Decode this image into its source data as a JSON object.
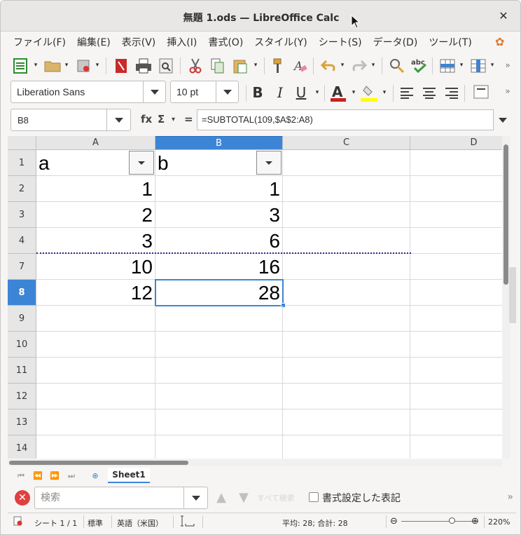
{
  "window": {
    "title": "無題 1.ods — LibreOffice Calc",
    "close": "✕"
  },
  "menubar": [
    "ファイル(F)",
    "編集(E)",
    "表示(V)",
    "挿入(I)",
    "書式(O)",
    "スタイル(Y)",
    "シート(S)",
    "データ(D)",
    "ツール(T)"
  ],
  "toolbar2": {
    "font_name": "Liberation Sans",
    "font_size": "10 pt",
    "bold": "B",
    "italic": "I",
    "underline": "U"
  },
  "formula_bar": {
    "name_box": "B8",
    "fx": "fx",
    "sigma": "Σ",
    "equals": "=",
    "formula": "=SUBTOTAL(109,$A$2:A8)"
  },
  "grid": {
    "columns": [
      "A",
      "B",
      "C",
      "D"
    ],
    "selected_column": "B",
    "rows": [
      {
        "num": "1",
        "a": "a",
        "b": "b"
      },
      {
        "num": "2",
        "a": "1",
        "b": "1"
      },
      {
        "num": "3",
        "a": "2",
        "b": "3"
      },
      {
        "num": "4",
        "a": "3",
        "b": "6"
      },
      {
        "num": "7",
        "a": "10",
        "b": "16"
      },
      {
        "num": "8",
        "a": "12",
        "b": "28"
      },
      {
        "num": "9",
        "a": "",
        "b": ""
      },
      {
        "num": "10",
        "a": "",
        "b": ""
      },
      {
        "num": "11",
        "a": "",
        "b": ""
      },
      {
        "num": "12",
        "a": "",
        "b": ""
      },
      {
        "num": "13",
        "a": "",
        "b": ""
      },
      {
        "num": "14",
        "a": "",
        "b": ""
      }
    ],
    "selected_row": "8"
  },
  "sheet_tabs": {
    "active": "Sheet1"
  },
  "find_bar": {
    "placeholder": "検索",
    "find_all": "すべて検索",
    "formatted_display": "書式設定した表記"
  },
  "status_bar": {
    "sheet": "シート 1 / 1",
    "page_style": "標準",
    "language": "英語（米国）",
    "summary": "平均: 28; 合計: 28",
    "zoom": "220%"
  },
  "colors": {
    "selection": "#3c85d6",
    "close_red": "#e04040"
  }
}
